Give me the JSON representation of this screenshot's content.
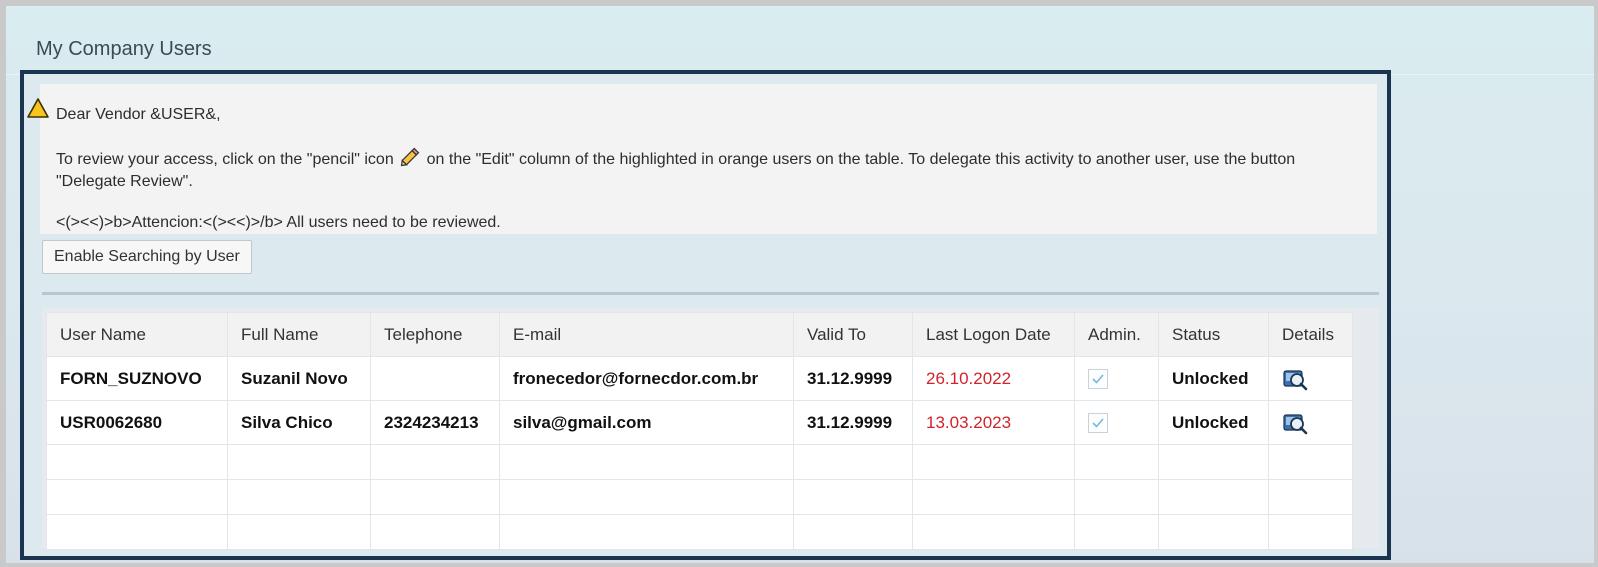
{
  "page": {
    "title": "My Company Users"
  },
  "message": {
    "icon": "warning-icon",
    "greeting": "Dear Vendor &USER&,",
    "body_before_icon": "To review your access, click on the \"pencil\" icon",
    "body_icon": "pencil-icon",
    "body_after_icon": " on the \"Edit\" column of the highlighted in orange users on the table. To delegate this activity to another user, use the button \"Delegate Review\".",
    "attention": "<(><<)>b>Attencion:<(><<)>/b> All users need to be reviewed."
  },
  "toolbar": {
    "search_toggle_label": "Enable Searching by User"
  },
  "table": {
    "headers": [
      "User Name",
      "Full Name",
      "Telephone",
      "E-mail",
      "Valid To",
      "Last Logon Date",
      "Admin.",
      "Status",
      "Details"
    ],
    "rows": [
      {
        "user_name": "FORN_SUZNOVO",
        "full_name": "Suzanil Novo",
        "telephone": "",
        "email": "fronecedor@fornecdor.com.br",
        "valid_to": "31.12.9999",
        "last_logon": "26.10.2022",
        "admin": true,
        "status": "Unlocked",
        "details_icon": "user-details-icon"
      },
      {
        "user_name": "USR0062680",
        "full_name": "Silva Chico",
        "telephone": "2324234213",
        "email": "silva@gmail.com",
        "valid_to": "31.12.9999",
        "last_logon": "13.03.2023",
        "admin": true,
        "status": "Unlocked",
        "details_icon": "user-details-icon"
      }
    ],
    "empty_rows": 3
  },
  "colors": {
    "panel_border": "#1b3550",
    "date_highlight": "#d0232b",
    "warning": "#f0b400"
  }
}
